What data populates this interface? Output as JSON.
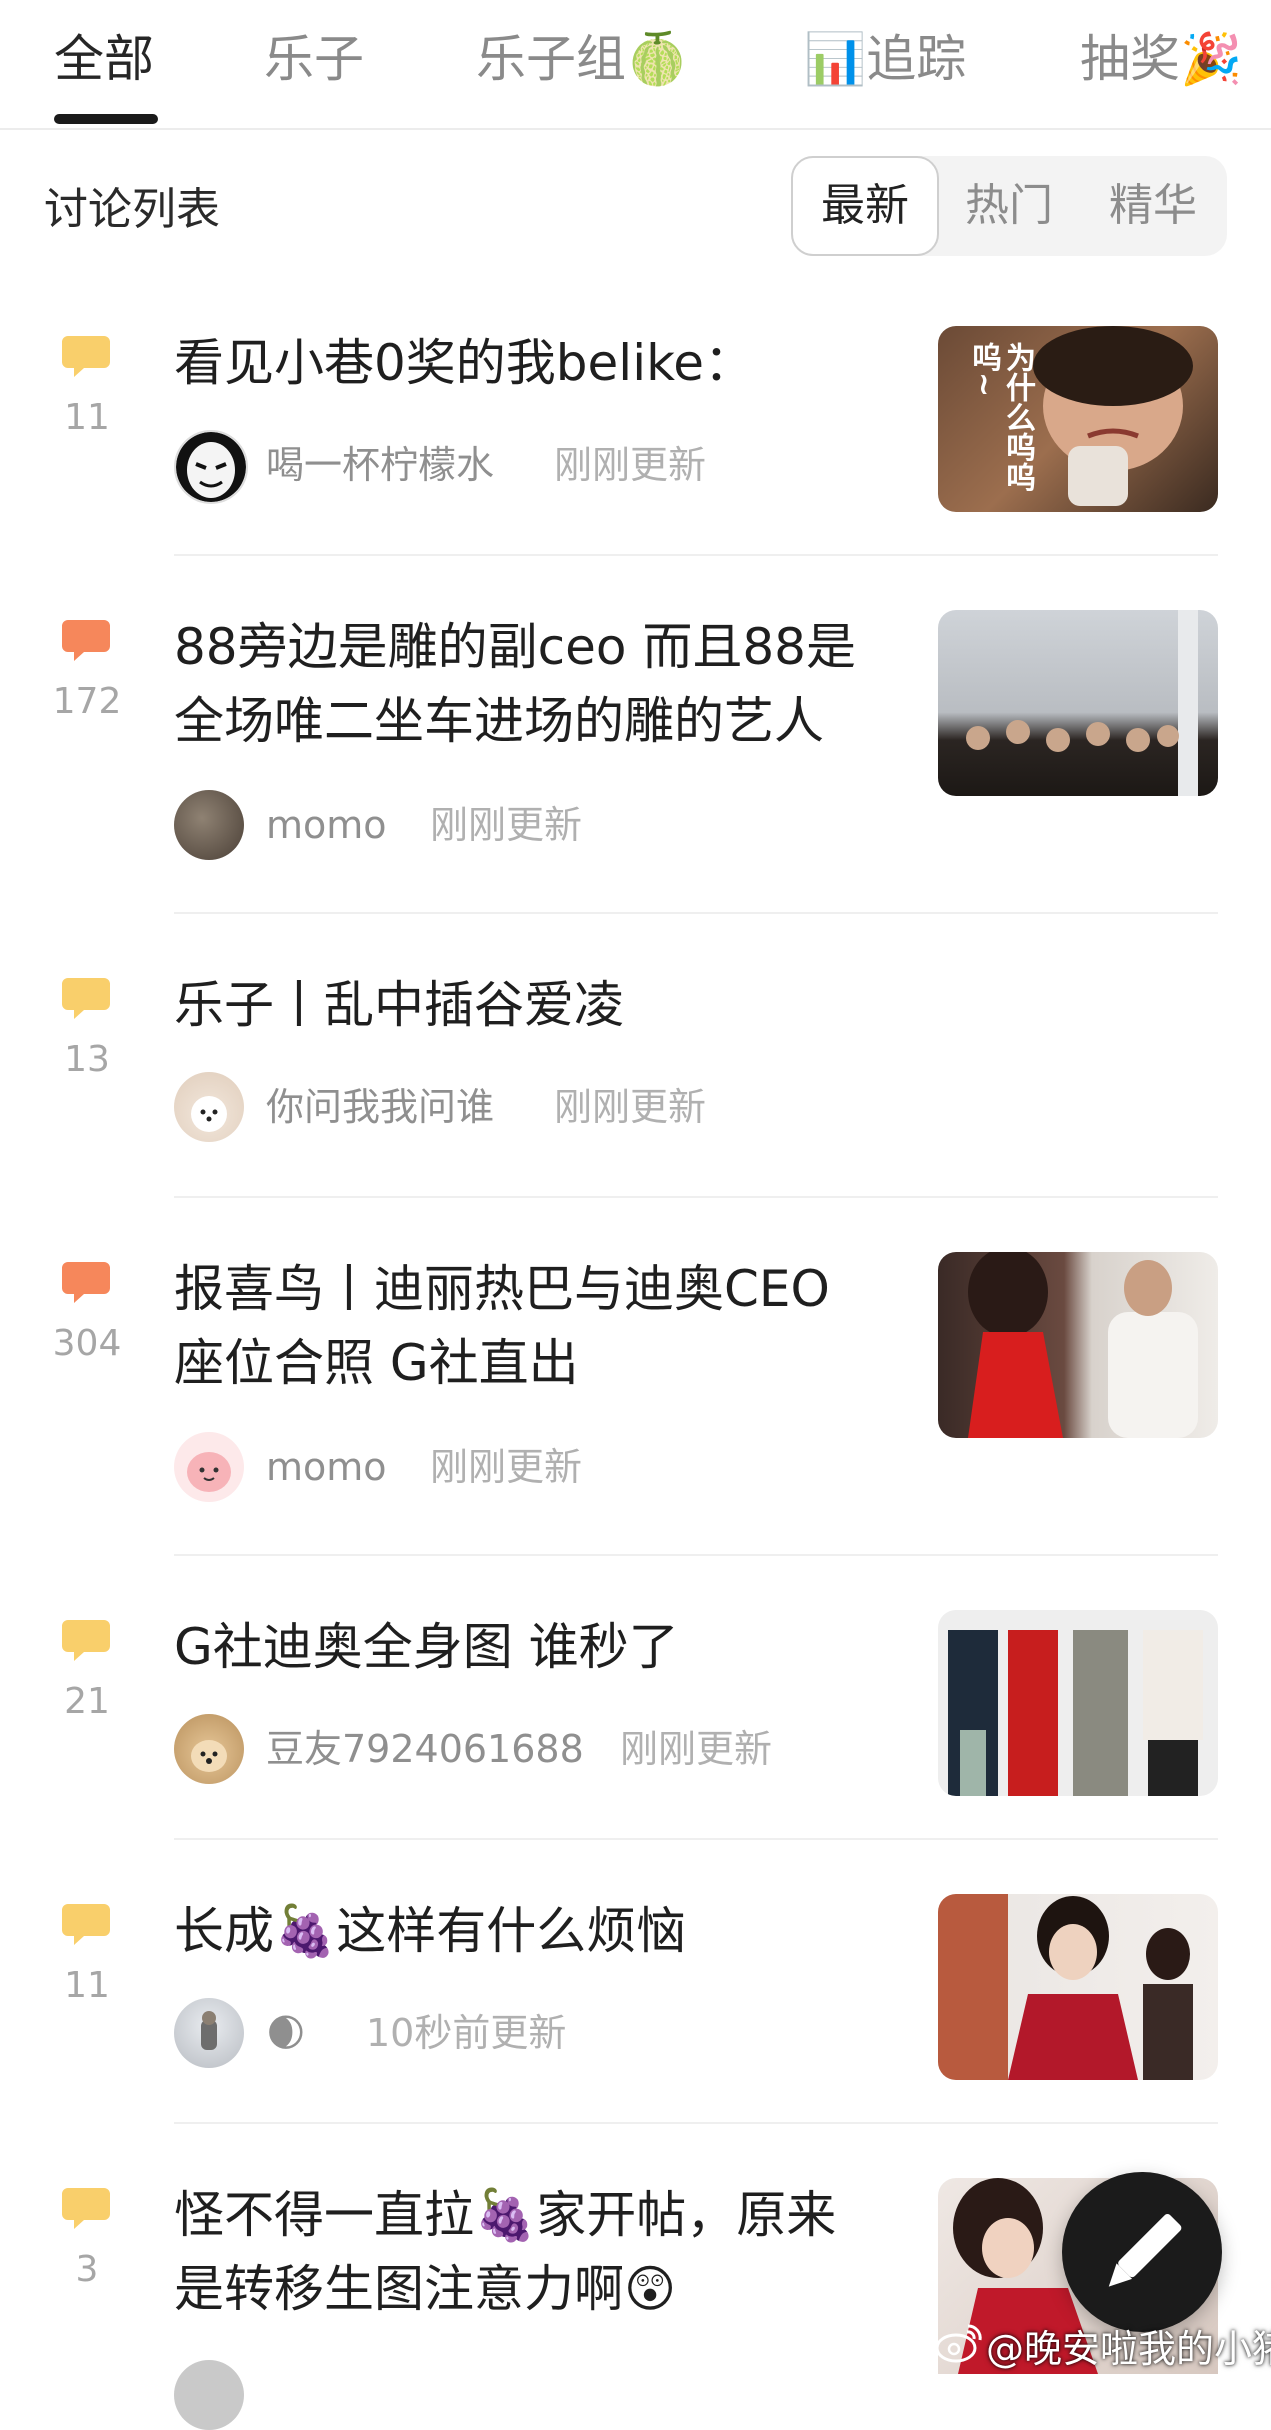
{
  "tabs": [
    {
      "label": "全部"
    },
    {
      "label": "乐子"
    },
    {
      "label": "乐子组🍈"
    },
    {
      "label": "📊追踪"
    },
    {
      "label": "抽奖🎉"
    }
  ],
  "section_title": "讨论列表",
  "sort_options": [
    "最新",
    "热门",
    "精华"
  ],
  "posts": [
    {
      "comments": "11",
      "title_lines": [
        "看见小巷0奖的我belike："
      ],
      "author": "喝一杯柠檬水",
      "updated": "刚刚更新",
      "thumb_text": "为什么呜呜呜~",
      "icon_color": "#f9cf6b"
    },
    {
      "comments": "172",
      "title_lines": [
        "88旁边是雕的副ceo 而且88是",
        "全场唯二坐车进场的雕的艺人"
      ],
      "author": "momo",
      "updated": "刚刚更新",
      "icon_color": "#f6875b"
    },
    {
      "comments": "13",
      "title_lines": [
        "乐子丨乱中插谷爱凌"
      ],
      "author": "你问我我问谁",
      "updated": "刚刚更新",
      "icon_color": "#f9cf6b"
    },
    {
      "comments": "304",
      "title_lines": [
        "报喜鸟丨迪丽热巴与迪奥CEO",
        "座位合照 G社直出"
      ],
      "author": "momo",
      "updated": "刚刚更新",
      "icon_color": "#f6875b"
    },
    {
      "comments": "21",
      "title_lines": [
        "G社迪奥全身图 谁秒了"
      ],
      "author": "豆友7924061688",
      "updated": "刚刚更新",
      "icon_color": "#f9cf6b"
    },
    {
      "comments": "11",
      "title_lines": [
        "长成🍇这样有什么烦恼"
      ],
      "author": "🌒",
      "updated": "10秒前更新",
      "icon_color": "#f9cf6b"
    },
    {
      "comments": "3",
      "title_lines": [
        "怪不得一直拉🍇家开帖，原来",
        "是转移生图注意力啊😲"
      ],
      "author": "",
      "updated": "",
      "icon_color": "#f9cf6b"
    }
  ],
  "watermark": "@晚安啦我的小猪",
  "icons": {
    "comment": "speech-bubble-icon",
    "compose": "pencil-icon",
    "weibo": "weibo-logo"
  }
}
